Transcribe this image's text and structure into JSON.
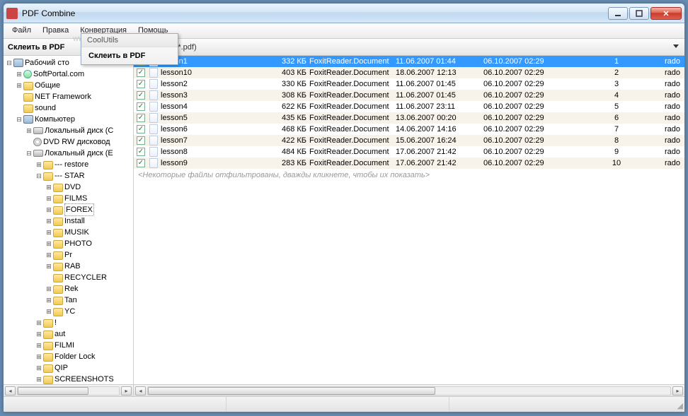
{
  "window": {
    "title": "PDF Combine"
  },
  "menu": {
    "file": "Файл",
    "edit": "Правка",
    "convert": "Конвертация",
    "help": "Помощь"
  },
  "toolbar": {
    "label": "Склеить в PDF",
    "filter_suffix": "*.pdf)"
  },
  "context": {
    "header": "CoolUtils",
    "item": "Склеить в PDF"
  },
  "watermark": "www.softportal.com",
  "tree": {
    "desktop": "Рабочий сто",
    "public": "Общие",
    "netfw": "NET Framework",
    "sound": "sound",
    "computer": "Компьютер",
    "localC": "Локальный диск (C",
    "dvd": "DVD RW дисковод",
    "localE": "Локальный диск (E",
    "restore": "---  restore",
    "star": "---  STAR",
    "dvdf": "DVD",
    "films": "FILMS",
    "forex": "FOREX",
    "install": "Install",
    "musik": "MUSIK",
    "photo": "PHOTO",
    "pr": "Pr",
    "rab": "RAB",
    "recycler": "RECYCLER",
    "rek": "Rek",
    "tan": "Tan",
    "yc": "YC",
    "excl": "!",
    "aut": "aut",
    "filmi": "FILMI",
    "flock": "Folder Lock",
    "qip": "QIP",
    "scr": "SCREENSHOTS",
    "softportal": "SoftPortal.com"
  },
  "files": [
    {
      "name": "lesson1",
      "size": "332 КБ",
      "type": "FoxitReader.Document",
      "d1": "11.06.2007 01:44",
      "d2": "06.10.2007 02:29",
      "num": "1",
      "user": "rado",
      "selected": true
    },
    {
      "name": "lesson10",
      "size": "403 КБ",
      "type": "FoxitReader.Document",
      "d1": "18.06.2007 12:13",
      "d2": "06.10.2007 02:29",
      "num": "2",
      "user": "rado"
    },
    {
      "name": "lesson2",
      "size": "330 КБ",
      "type": "FoxitReader.Document",
      "d1": "11.06.2007 01:45",
      "d2": "06.10.2007 02:29",
      "num": "3",
      "user": "rado"
    },
    {
      "name": "lesson3",
      "size": "308 КБ",
      "type": "FoxitReader.Document",
      "d1": "11.06.2007 01:45",
      "d2": "06.10.2007 02:29",
      "num": "4",
      "user": "rado"
    },
    {
      "name": "lesson4",
      "size": "622 КБ",
      "type": "FoxitReader.Document",
      "d1": "11.06.2007 23:11",
      "d2": "06.10.2007 02:29",
      "num": "5",
      "user": "rado"
    },
    {
      "name": "lesson5",
      "size": "435 КБ",
      "type": "FoxitReader.Document",
      "d1": "13.06.2007 00:20",
      "d2": "06.10.2007 02:29",
      "num": "6",
      "user": "rado"
    },
    {
      "name": "lesson6",
      "size": "468 КБ",
      "type": "FoxitReader.Document",
      "d1": "14.06.2007 14:16",
      "d2": "06.10.2007 02:29",
      "num": "7",
      "user": "rado"
    },
    {
      "name": "lesson7",
      "size": "422 КБ",
      "type": "FoxitReader.Document",
      "d1": "15.06.2007 16:24",
      "d2": "06.10.2007 02:29",
      "num": "8",
      "user": "rado"
    },
    {
      "name": "lesson8",
      "size": "484 КБ",
      "type": "FoxitReader.Document",
      "d1": "17.06.2007 21:42",
      "d2": "06.10.2007 02:29",
      "num": "9",
      "user": "rado"
    },
    {
      "name": "lesson9",
      "size": "283 КБ",
      "type": "FoxitReader.Document",
      "d1": "17.06.2007 21:42",
      "d2": "06.10.2007 02:29",
      "num": "10",
      "user": "rado"
    }
  ],
  "filtered_hint": "<Некоторые файлы отфильтрованы, дважды кликнете, чтобы их показать>"
}
